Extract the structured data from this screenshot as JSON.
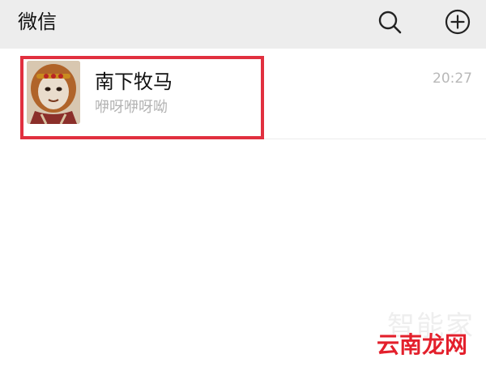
{
  "header": {
    "title": "微信",
    "icons": [
      "search-icon",
      "plus-circle-icon"
    ]
  },
  "chat_list": [
    {
      "name": "南下牧马",
      "preview": "咿呀咿呀呦",
      "time": "20:27",
      "avatar": "monkey-king-avatar",
      "highlighted": true
    }
  ],
  "watermark": {
    "top_text": "智能家",
    "main_text": "云南龙网"
  },
  "colors": {
    "header_bg": "#ededed",
    "highlight": "#e1303f",
    "watermark_red": "#e3202c"
  }
}
